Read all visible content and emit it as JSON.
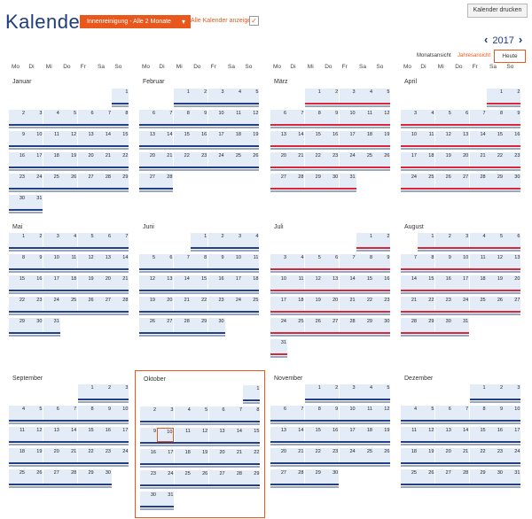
{
  "header": {
    "title": "Kalender",
    "filter_label": "Innenreinigung - Alle 2 Monate",
    "all_calendars_label": "Alle Kalender anzeigen",
    "all_calendars_checked": true,
    "print_label": "Kalender drucken"
  },
  "nav": {
    "year": "2017",
    "prev_icon": "chevron-left-icon",
    "next_icon": "chevron-right-icon",
    "month_view": "Monatsansicht",
    "year_view": "Jahresansicht",
    "today_label": "Heute"
  },
  "weekdays": [
    "Mo",
    "Di",
    "Mi",
    "Do",
    "Fr",
    "Sa",
    "So"
  ],
  "months": [
    {
      "name": "Januar",
      "offset": 6,
      "days": 31
    },
    {
      "name": "Februar",
      "offset": 2,
      "days": 28
    },
    {
      "name": "März",
      "offset": 2,
      "days": 31
    },
    {
      "name": "April",
      "offset": 5,
      "days": 30
    },
    {
      "name": "Mai",
      "offset": 0,
      "days": 31
    },
    {
      "name": "Juni",
      "offset": 3,
      "days": 30
    },
    {
      "name": "Juli",
      "offset": 5,
      "days": 31
    },
    {
      "name": "August",
      "offset": 1,
      "days": 31
    },
    {
      "name": "September",
      "offset": 4,
      "days": 30
    },
    {
      "name": "Oktober",
      "offset": 6,
      "days": 31
    },
    {
      "name": "November",
      "offset": 2,
      "days": 30
    },
    {
      "name": "Dezember",
      "offset": 4,
      "days": 31
    }
  ],
  "selected_month": "Oktober",
  "today": {
    "month": "Oktober",
    "day": 10
  },
  "colors": {
    "accent": "#e8581c",
    "navy": "#1f3d7a",
    "event_blue": "#22408a",
    "event_red": "#d8263c",
    "event_gray": "#9aa7bf",
    "cell": "#e4ecf7"
  }
}
